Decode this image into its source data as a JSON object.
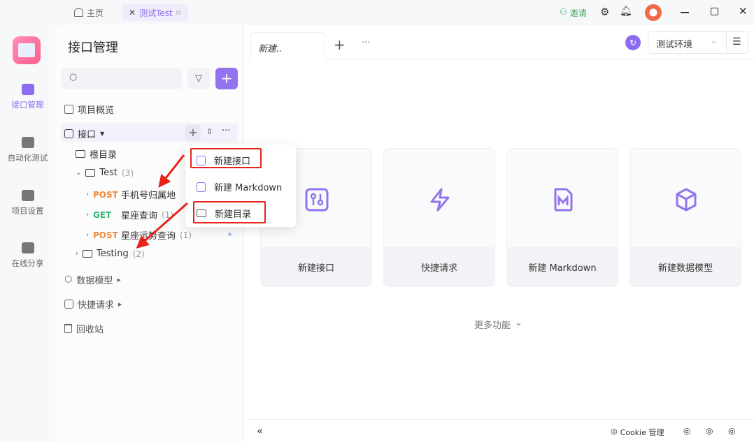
{
  "topbar": {
    "home_tab": "主页",
    "project_tab": "测试Test",
    "invite": "邀请"
  },
  "leftnav": [
    {
      "label": "接口管理",
      "active": true
    },
    {
      "label": "自动化测试"
    },
    {
      "label": "项目设置"
    },
    {
      "label": "在线分享"
    }
  ],
  "sidebar": {
    "title": "接口管理",
    "overview": "项目概览",
    "api_root": "接口",
    "tree": {
      "root": "根目录",
      "folder1": "Test",
      "folder1_count": "(3)",
      "items": [
        {
          "method": "POST",
          "name": "手机号归属地"
        },
        {
          "method": "GET",
          "name": "星座查询",
          "count": "(1)"
        },
        {
          "method": "POST",
          "name": "星座运势查询",
          "count": "(1)"
        }
      ],
      "folder2": "Testing",
      "folder2_count": "(2)"
    },
    "data_model": "数据模型",
    "quick_request": "快捷请求",
    "trash": "回收站"
  },
  "menu": {
    "items": [
      "新建接口",
      "新建 Markdown",
      "新建目录"
    ]
  },
  "main": {
    "tab": "新建..",
    "environment": "测试环境",
    "cards": [
      "新建接口",
      "快捷请求",
      "新建 Markdown",
      "新建数据模型"
    ],
    "more": "更多功能"
  },
  "footer": {
    "cookie": "Cookie 管理"
  },
  "colors": {
    "accent": "#8c6cf0",
    "post": "#f0883a",
    "get": "#2bb673",
    "invite": "#3aa757",
    "annotation": "#e8231a"
  }
}
